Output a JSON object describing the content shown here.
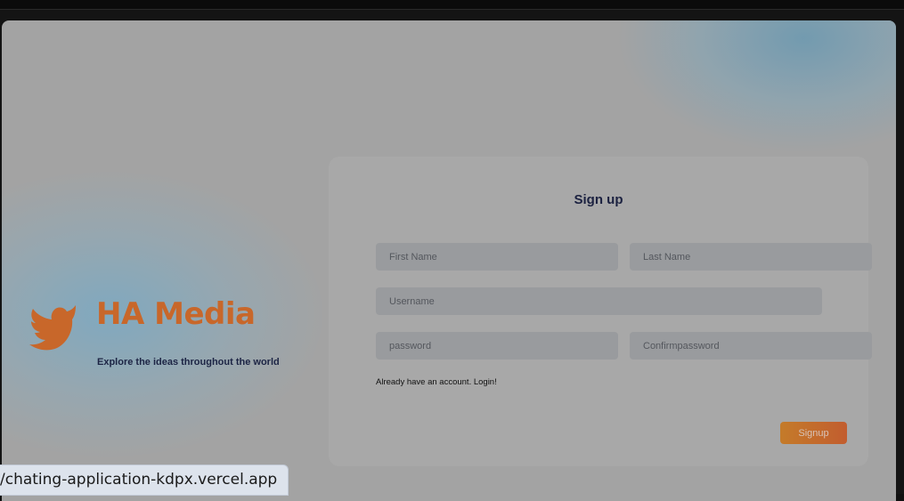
{
  "brand": {
    "title": "HA Media",
    "tagline": "Explore the ideas throughout the world",
    "logo_icon": "bird-icon",
    "accent_color": "#c8672a"
  },
  "signup_form": {
    "title": "Sign up",
    "first_name_placeholder": "First Name",
    "last_name_placeholder": "Last Name",
    "username_placeholder": "Username",
    "password_placeholder": "password",
    "confirm_password_placeholder": "Confirmpassword",
    "login_link": "Already have an account. Login!",
    "submit_label": "Signup"
  },
  "status_bar": {
    "url": "/chating-application-kdpx.vercel.app"
  }
}
